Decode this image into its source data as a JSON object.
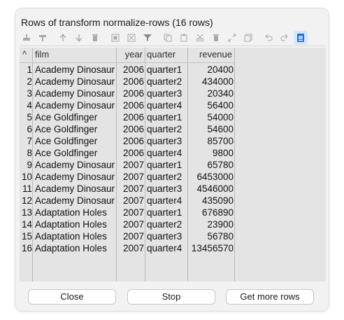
{
  "window": {
    "title": "Rows of transform normalize-rows (16 rows)"
  },
  "toolbar": {
    "icons": [
      "insert-row-icon",
      "delete-row-icon",
      "move-up-icon",
      "move-down-icon",
      "trash-icon",
      "select-all-icon",
      "clear-selection-icon",
      "filter-icon",
      "copy-icon",
      "paste-icon",
      "cut-icon",
      "delete-icon",
      "expand-icon",
      "duplicate-icon",
      "undo-icon",
      "redo-icon",
      "data-view-icon"
    ]
  },
  "table": {
    "sort_indicator": "^",
    "columns": [
      "film",
      "year",
      "quarter",
      "revenue"
    ],
    "rows": [
      [
        "1",
        "Academy Dinosaur",
        "2006",
        "quarter1",
        "20400"
      ],
      [
        "2",
        "Academy Dinosaur",
        "2006",
        "quarter2",
        "434000"
      ],
      [
        "3",
        "Academy Dinosaur",
        "2006",
        "quarter3",
        "20340"
      ],
      [
        "4",
        "Academy Dinosaur",
        "2006",
        "quarter4",
        "56400"
      ],
      [
        "5",
        "Ace Goldfinger",
        "2006",
        "quarter1",
        "54000"
      ],
      [
        "6",
        "Ace Goldfinger",
        "2006",
        "quarter2",
        "54600"
      ],
      [
        "7",
        "Ace Goldfinger",
        "2006",
        "quarter3",
        "85700"
      ],
      [
        "8",
        "Ace Goldfinger",
        "2006",
        "quarter4",
        "9800"
      ],
      [
        "9",
        "Academy Dinosaur",
        "2007",
        "quarter1",
        "65780"
      ],
      [
        "10",
        "Academy Dinosaur",
        "2007",
        "quarter2",
        "6453000"
      ],
      [
        "11",
        "Academy Dinosaur",
        "2007",
        "quarter3",
        "4546000"
      ],
      [
        "12",
        "Academy Dinosaur",
        "2007",
        "quarter4",
        "435090"
      ],
      [
        "13",
        "Adaptation Holes",
        "2007",
        "quarter1",
        "676890"
      ],
      [
        "14",
        "Adaptation Holes",
        "2007",
        "quarter2",
        "23900"
      ],
      [
        "15",
        "Adaptation Holes",
        "2007",
        "quarter3",
        "56780"
      ],
      [
        "16",
        "Adaptation Holes",
        "2007",
        "quarter4",
        "13456570"
      ]
    ]
  },
  "buttons": {
    "close": "Close",
    "stop": "Stop",
    "more": "Get more rows"
  },
  "colors": {
    "accent": "#1e6fd9",
    "grid_bg": "#e4e4e4",
    "disabled_icon": "#a8a8a8"
  }
}
